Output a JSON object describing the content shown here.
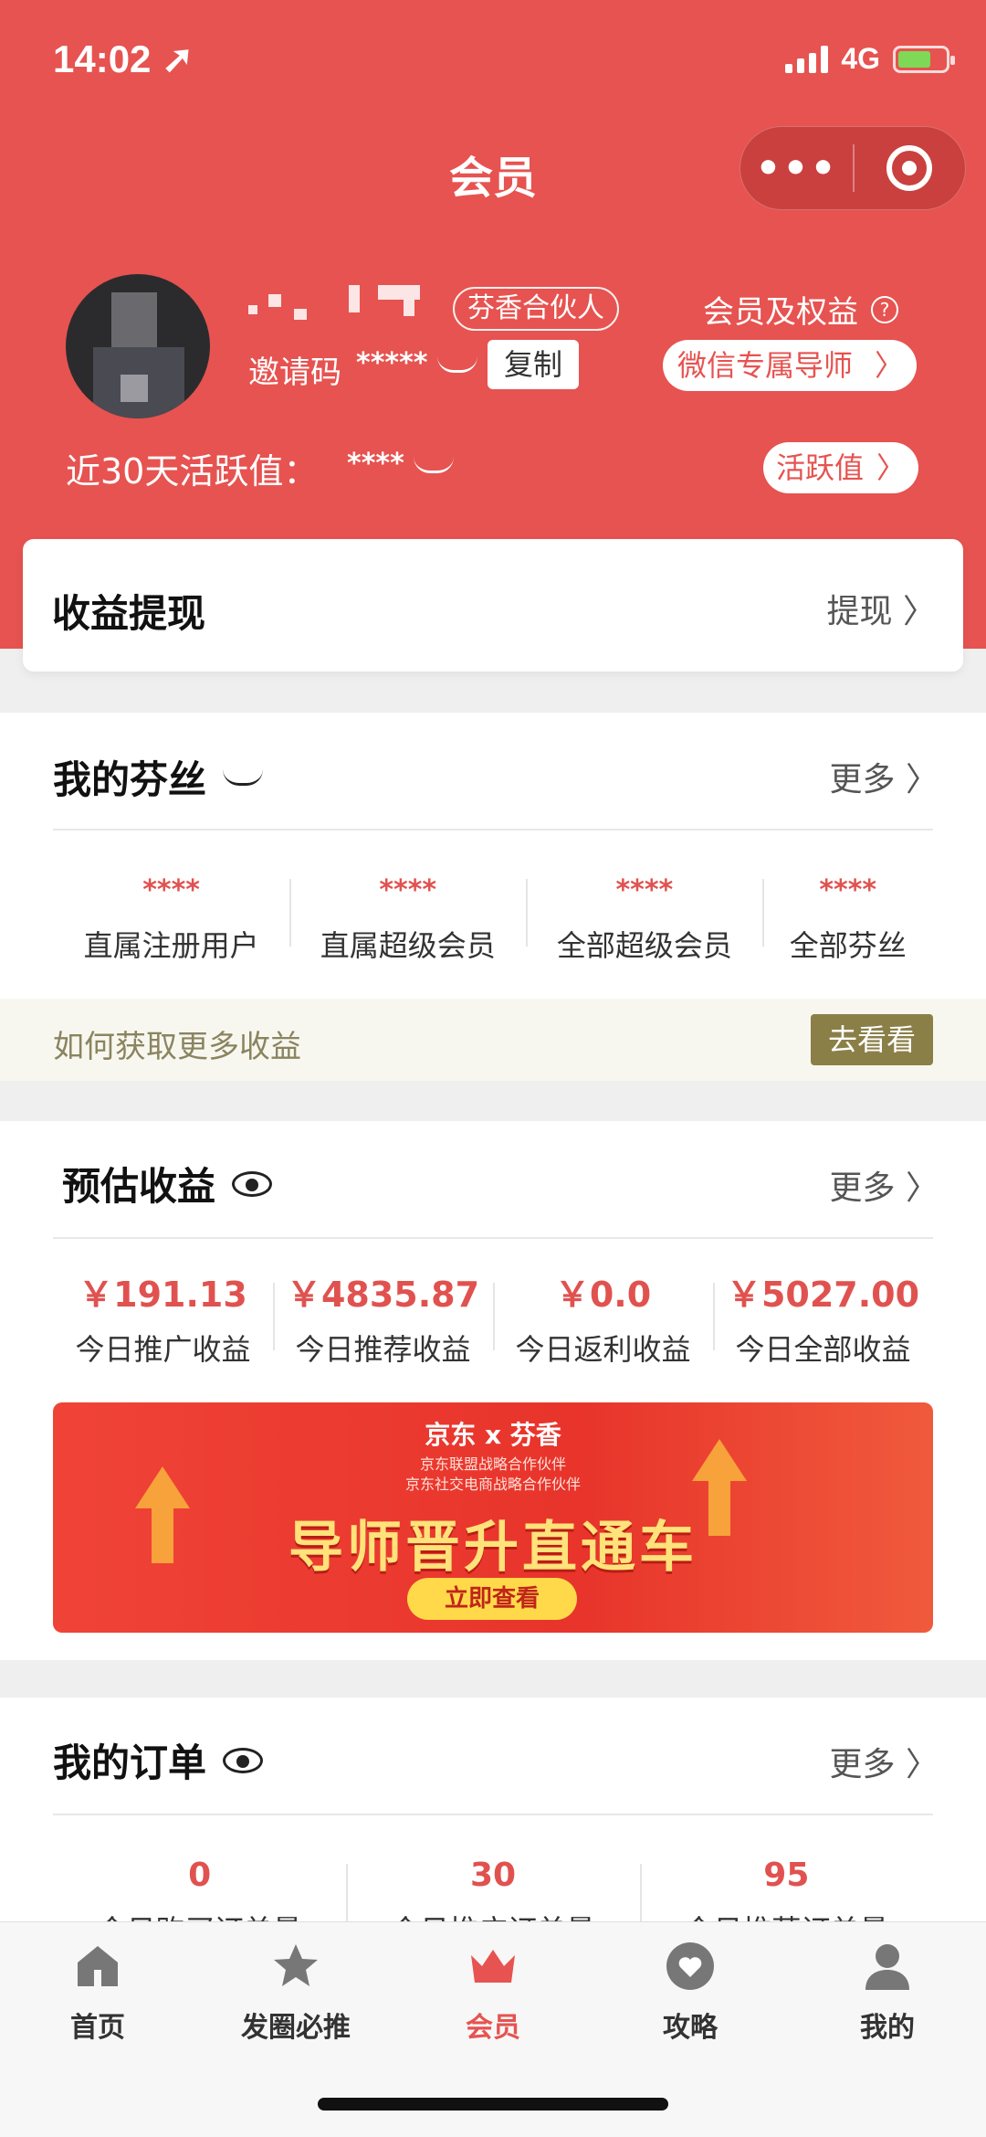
{
  "status": {
    "time": "14:02",
    "network": "4G"
  },
  "nav": {
    "title": "会员",
    "more_dots": "•••"
  },
  "profile": {
    "badge": "芬香合伙人",
    "invite_label": "邀请码",
    "invite_code": "*****",
    "copy_label": "复制",
    "benefits_label": "会员及权益",
    "mentor_button": "微信专属导师",
    "activity_label": "近30天活跃值：",
    "activity_value": "****",
    "activity_button": "活跃值"
  },
  "withdraw": {
    "title": "收益提现",
    "link": "提现"
  },
  "fans": {
    "title": "我的芬丝",
    "more": "更多",
    "stats": [
      {
        "value": "****",
        "label": "直属注册用户"
      },
      {
        "value": "****",
        "label": "直属超级会员"
      },
      {
        "value": "****",
        "label": "全部超级会员"
      },
      {
        "value": "****",
        "label": "全部芬丝"
      }
    ],
    "tip": "如何获取更多收益",
    "tip_button": "去看看"
  },
  "earnings": {
    "title": "预估收益",
    "more": "更多",
    "stats": [
      {
        "value": "￥191.13",
        "label": "今日推广收益"
      },
      {
        "value": "￥4835.87",
        "label": "今日推荐收益"
      },
      {
        "value": "￥0.0",
        "label": "今日返利收益"
      },
      {
        "value": "￥5027.00",
        "label": "今日全部收益"
      }
    ],
    "banner": {
      "brand": "京东 x 芬香",
      "line1": "京东联盟战略合作伙伴",
      "line2": "京东社交电商战略合作伙伴",
      "headline": "导师晋升直通车",
      "cta": "立即查看"
    }
  },
  "orders": {
    "title": "我的订单",
    "more": "更多",
    "stats": [
      {
        "value": "0",
        "label": "今日购买订单量"
      },
      {
        "value": "30",
        "label": "今日推广订单量"
      },
      {
        "value": "95",
        "label": "今日推荐订单量"
      }
    ]
  },
  "tabbar": [
    {
      "label": "首页",
      "icon": "home-icon"
    },
    {
      "label": "发圈必推",
      "icon": "star-icon"
    },
    {
      "label": "会员",
      "icon": "crown-icon"
    },
    {
      "label": "攻略",
      "icon": "heart-icon"
    },
    {
      "label": "我的",
      "icon": "user-icon"
    }
  ],
  "colors": {
    "brand": "#e65350",
    "accent_value": "#e0524f",
    "tip_button": "#8b7f48",
    "banner_headline": "#ffe27a"
  }
}
